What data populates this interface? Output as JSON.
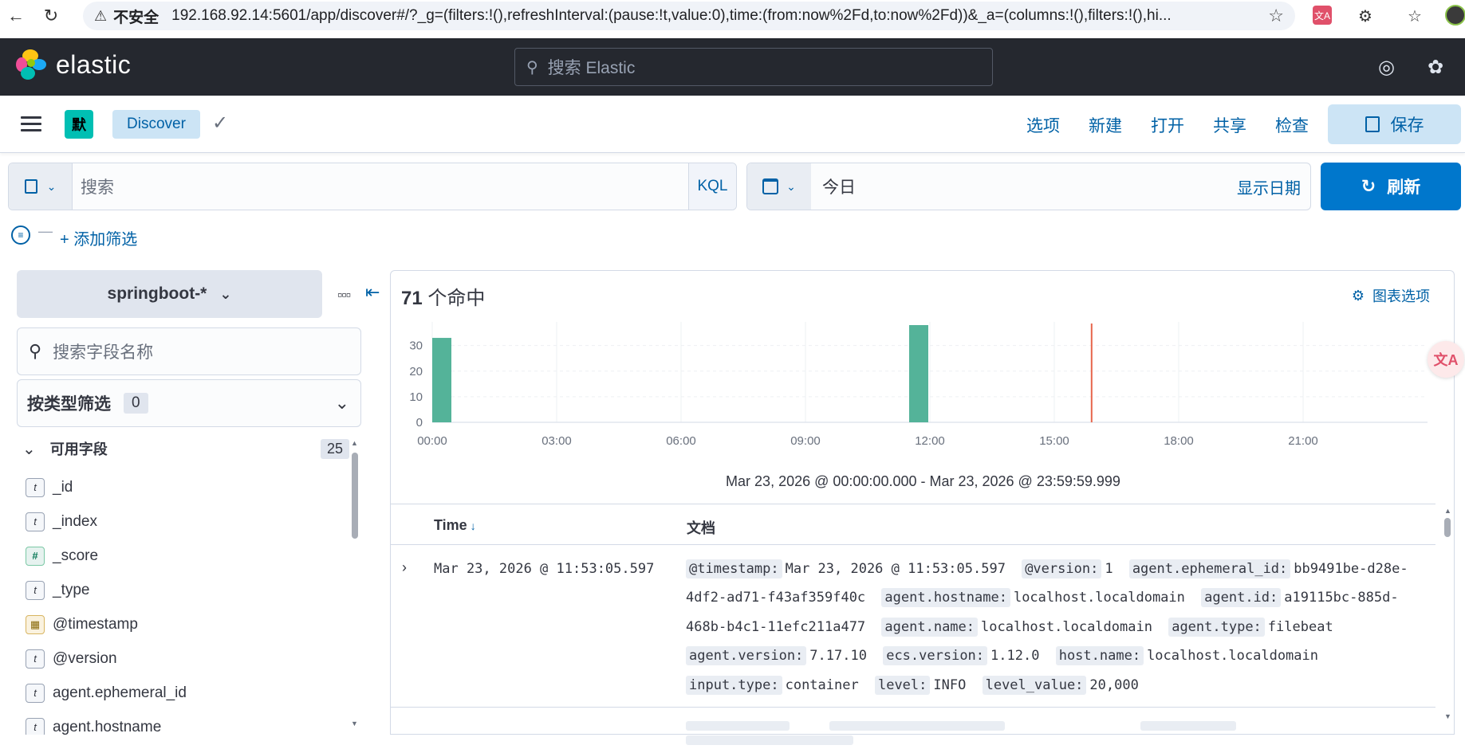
{
  "browser": {
    "insecure_label": "不安全",
    "url": "192.168.92.14:5601/app/discover#/?_g=(filters:!(),refreshInterval:(pause:!t,value:0),time:(from:now%2Fd,to:now%2Fd))&_a=(columns:!(),filters:!(),hi..."
  },
  "header": {
    "brand": "elastic",
    "search_placeholder": "搜索 Elastic"
  },
  "subnav": {
    "space_initial": "默",
    "breadcrumb": "Discover",
    "links": [
      "选项",
      "新建",
      "打开",
      "共享",
      "检查"
    ],
    "save_label": "保存"
  },
  "query": {
    "placeholder": "搜索",
    "language": "KQL",
    "date_value": "今日",
    "show_dates": "显示日期",
    "refresh_label": "刷新",
    "add_filter": "+ 添加筛选"
  },
  "sidebar": {
    "index_pattern": "springboot-*",
    "field_search_placeholder": "搜索字段名称",
    "type_filter_label": "按类型筛选",
    "type_filter_count": "0",
    "available_label": "可用字段",
    "available_count": "25",
    "fields": [
      {
        "type": "t",
        "name": "_id"
      },
      {
        "type": "t",
        "name": "_index"
      },
      {
        "type": "#",
        "name": "_score"
      },
      {
        "type": "t",
        "name": "_type"
      },
      {
        "type": "date",
        "name": "@timestamp"
      },
      {
        "type": "t",
        "name": "@version"
      },
      {
        "type": "t",
        "name": "agent.ephemeral_id"
      },
      {
        "type": "t",
        "name": "agent.hostname"
      }
    ]
  },
  "main": {
    "hits_count": "71",
    "hits_suffix": " 个命中",
    "chart_options": "图表选项",
    "time_range": "Mar 23, 2026 @ 00:00:00.000 - Mar 23, 2026 @ 23:59:59.999",
    "col_time": "Time",
    "col_doc": "文档",
    "row": {
      "time": "Mar 23, 2026 @ 11:53:05.597",
      "fields": [
        {
          "k": "@timestamp:",
          "v": "Mar 23, 2026 @ 11:53:05.597"
        },
        {
          "k": "@version:",
          "v": "1"
        },
        {
          "k": "agent.ephemeral_id:",
          "v": "bb9491be-d28e-4df2-ad71-f43af359f40c"
        },
        {
          "k": "agent.hostname:",
          "v": "localhost.localdomain"
        },
        {
          "k": "agent.id:",
          "v": "a19115bc-885d-468b-b4c1-11efc211a477"
        },
        {
          "k": "agent.name:",
          "v": "localhost.localdomain"
        },
        {
          "k": "agent.type:",
          "v": "filebeat"
        },
        {
          "k": "agent.version:",
          "v": "7.17.10"
        },
        {
          "k": "ecs.version:",
          "v": "1.12.0"
        },
        {
          "k": "host.name:",
          "v": "localhost.localdomain"
        },
        {
          "k": "input.type:",
          "v": "container"
        },
        {
          "k": "level:",
          "v": "INFO"
        },
        {
          "k": "level_value:",
          "v": "20,000"
        }
      ]
    }
  },
  "chart_data": {
    "type": "bar",
    "x_tick_labels": [
      "00:00",
      "03:00",
      "06:00",
      "09:00",
      "12:00",
      "15:00",
      "18:00",
      "21:00"
    ],
    "y_tick_labels": [
      "0",
      "10",
      "20",
      "30"
    ],
    "ylim": [
      0,
      38
    ],
    "xlim_hours": [
      0,
      24
    ],
    "bars": [
      {
        "hour": 0.0,
        "value": 33
      },
      {
        "hour": 11.5,
        "value": 38
      }
    ],
    "bar_width_hours": 0.5,
    "now_marker_hour": 15.9,
    "bar_color": "#54b399",
    "marker_color": "#e7664c"
  }
}
